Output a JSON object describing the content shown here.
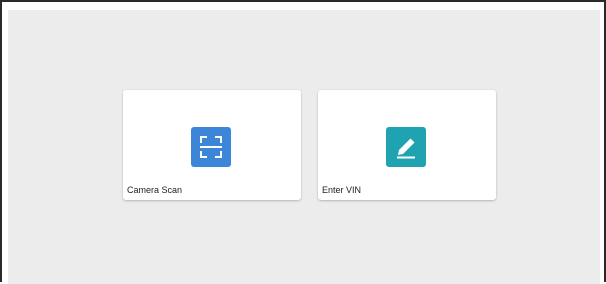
{
  "options": [
    {
      "label": "Camera Scan",
      "icon": "scan-frame-icon",
      "tile_color": "#3b86d6"
    },
    {
      "label": "Enter VIN",
      "icon": "pencil-edit-icon",
      "tile_color": "#1fa3b0"
    }
  ],
  "colors": {
    "background": "#ececec",
    "card": "#ffffff",
    "text": "#222222"
  }
}
